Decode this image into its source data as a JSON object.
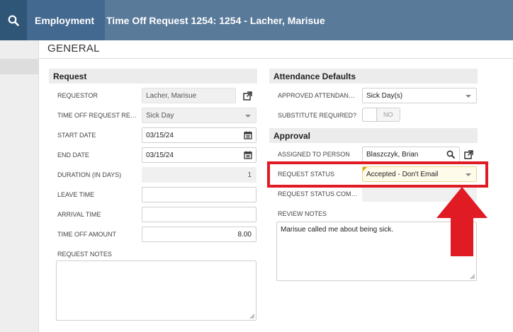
{
  "header": {
    "search_icon": "search-icon",
    "breadcrumb_module": "Employment",
    "breadcrumb_title": "Time Off Request 1254: 1254 - Lacher, Marisue"
  },
  "page": {
    "title": "GENERAL"
  },
  "request": {
    "section_title": "Request",
    "requestor_label": "REQUESTOR",
    "requestor_value": "Lacher, Marisue",
    "reason_label": "TIME OFF REQUEST REAS...",
    "reason_value": "Sick Day",
    "start_label": "START DATE",
    "start_value": "03/15/24",
    "end_label": "END DATE",
    "end_value": "03/15/24",
    "duration_label": "DURATION (IN DAYS)",
    "duration_value": "1",
    "leave_label": "LEAVE TIME",
    "leave_value": "",
    "arrival_label": "ARRIVAL TIME",
    "arrival_value": "",
    "amount_label": "TIME OFF AMOUNT",
    "amount_value": "8.00",
    "notes_label": "REQUEST NOTES",
    "notes_value": ""
  },
  "attendance": {
    "section_title": "Attendance Defaults",
    "approved_label": "APPROVED ATTENDANCE ...",
    "approved_value": "Sick Day(s)",
    "substitute_label": "SUBSTITUTE REQUIRED?",
    "substitute_value": "NO"
  },
  "approval": {
    "section_title": "Approval",
    "assigned_label": "ASSIGNED TO PERSON",
    "assigned_value": "Blaszczyk, Brian",
    "status_label": "REQUEST STATUS",
    "status_value": "Accepted - Don't Email",
    "status_comp_label": "REQUEST STATUS COMPL...",
    "status_comp_value": "",
    "review_label": "REVIEW NOTES",
    "review_value": "Marisue called me about being sick."
  },
  "colors": {
    "highlight": "#e01b24",
    "header_bg": "#5a7a9a",
    "breadcrumb_bg": "#436990",
    "search_bg": "#2f5577"
  }
}
